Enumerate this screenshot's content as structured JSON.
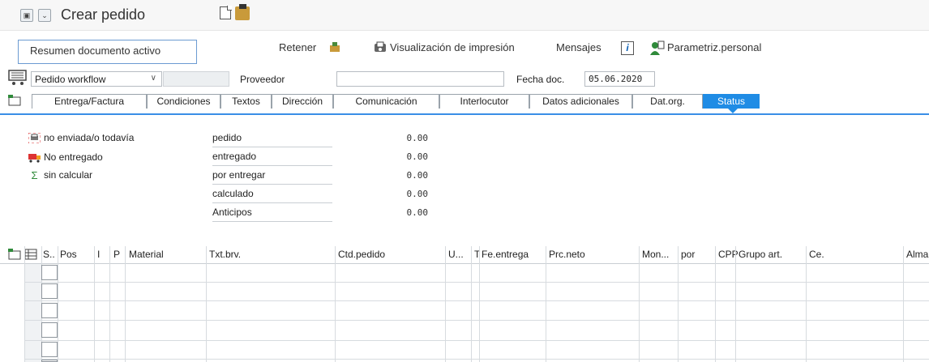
{
  "window": {
    "title": "Crear pedido"
  },
  "toolbar": {
    "resumen_label": "Resumen documento activo",
    "retener_label": "Retener",
    "visualizacion_label": "Visualización de impresión",
    "mensajes_label": "Mensajes",
    "info_glyph": "i",
    "parametriz_label": "Parametriz.personal"
  },
  "header": {
    "doc_type_value": "Pedido workflow",
    "proveedor_label": "Proveedor",
    "proveedor_value": "",
    "fecha_label": "Fecha doc.",
    "fecha_value": "05.06.2020"
  },
  "tabs": [
    {
      "label": "Entrega/Factura",
      "active": false
    },
    {
      "label": "Condiciones",
      "active": false
    },
    {
      "label": "Textos",
      "active": false
    },
    {
      "label": "Dirección",
      "active": false
    },
    {
      "label": "Comunicación",
      "active": false
    },
    {
      "label": "Interlocutor",
      "active": false
    },
    {
      "label": "Datos adicionales",
      "active": false
    },
    {
      "label": "Dat.org.",
      "active": false
    },
    {
      "label": "Status",
      "active": true
    }
  ],
  "status": {
    "left": [
      {
        "icon": "printer-icon",
        "label": "no enviada/o todavía"
      },
      {
        "icon": "truck-icon",
        "label": "No entregado"
      },
      {
        "icon": "sigma-icon",
        "label": "sin calcular"
      }
    ],
    "metrics": [
      {
        "label": "pedido",
        "value": "0.00"
      },
      {
        "label": "entregado",
        "value": "0.00"
      },
      {
        "label": "por entregar",
        "value": "0.00"
      },
      {
        "label": "calculado",
        "value": "0.00"
      },
      {
        "label": "Anticipos",
        "value": "0.00"
      }
    ]
  },
  "grid": {
    "columns": [
      "S..",
      "Pos",
      "I",
      "P",
      "Material",
      "Txt.brv.",
      "Ctd.pedido",
      "U...",
      "T",
      "Fe.entrega",
      "Prc.neto",
      "Mon...",
      "por",
      "CPP",
      "Grupo art.",
      "Ce.",
      "Alma"
    ],
    "rows": 6
  },
  "colors": {
    "accent": "#1f8ce5",
    "focus_border": "#6c9bd2"
  }
}
